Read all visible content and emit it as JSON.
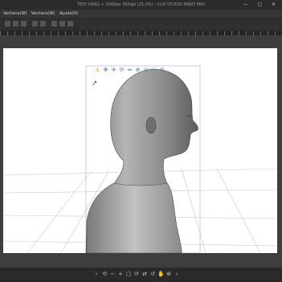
{
  "window": {
    "title": "TEST HEAD + 2000px 350dpi (25.0%) - CLIP STUDIO PAINT PRO",
    "controls": "— ▢ ✕"
  },
  "menubar": {
    "items": [
      "Ventana(W)",
      "Ventana(W)",
      "Ayuda(H)"
    ]
  },
  "viewport": {
    "canvas_color": "#ffffff",
    "grid_color": "#c8c8c8",
    "guide_color": "#a8a8d8",
    "figure_color": "#8f8f8f"
  },
  "model_widget": {
    "icons": [
      "anchor-icon",
      "move-icon",
      "move-icon",
      "rotate-icon",
      "pan-icon",
      "zoom-icon",
      "view-icon",
      "fit-icon",
      "reset-icon"
    ],
    "glyphs": [
      "⚓",
      "✥",
      "✛",
      "⟳",
      "⇔",
      "⊕",
      "◎",
      "⬚",
      "⟲"
    ]
  },
  "navigator": {
    "icons": [
      "rotate-left-icon",
      "zoom-out-icon",
      "zoom-in-icon",
      "fit-icon",
      "rotate-right-icon",
      "flip-icon",
      "reset-icon",
      "hand-icon",
      "zoom-icon",
      "pan-icon",
      "close-icon"
    ],
    "glyphs": [
      "‹",
      "⟲",
      "−",
      "+",
      "▢",
      "⟳",
      "⇄",
      "↺",
      "✋",
      "⊕",
      "›"
    ]
  }
}
